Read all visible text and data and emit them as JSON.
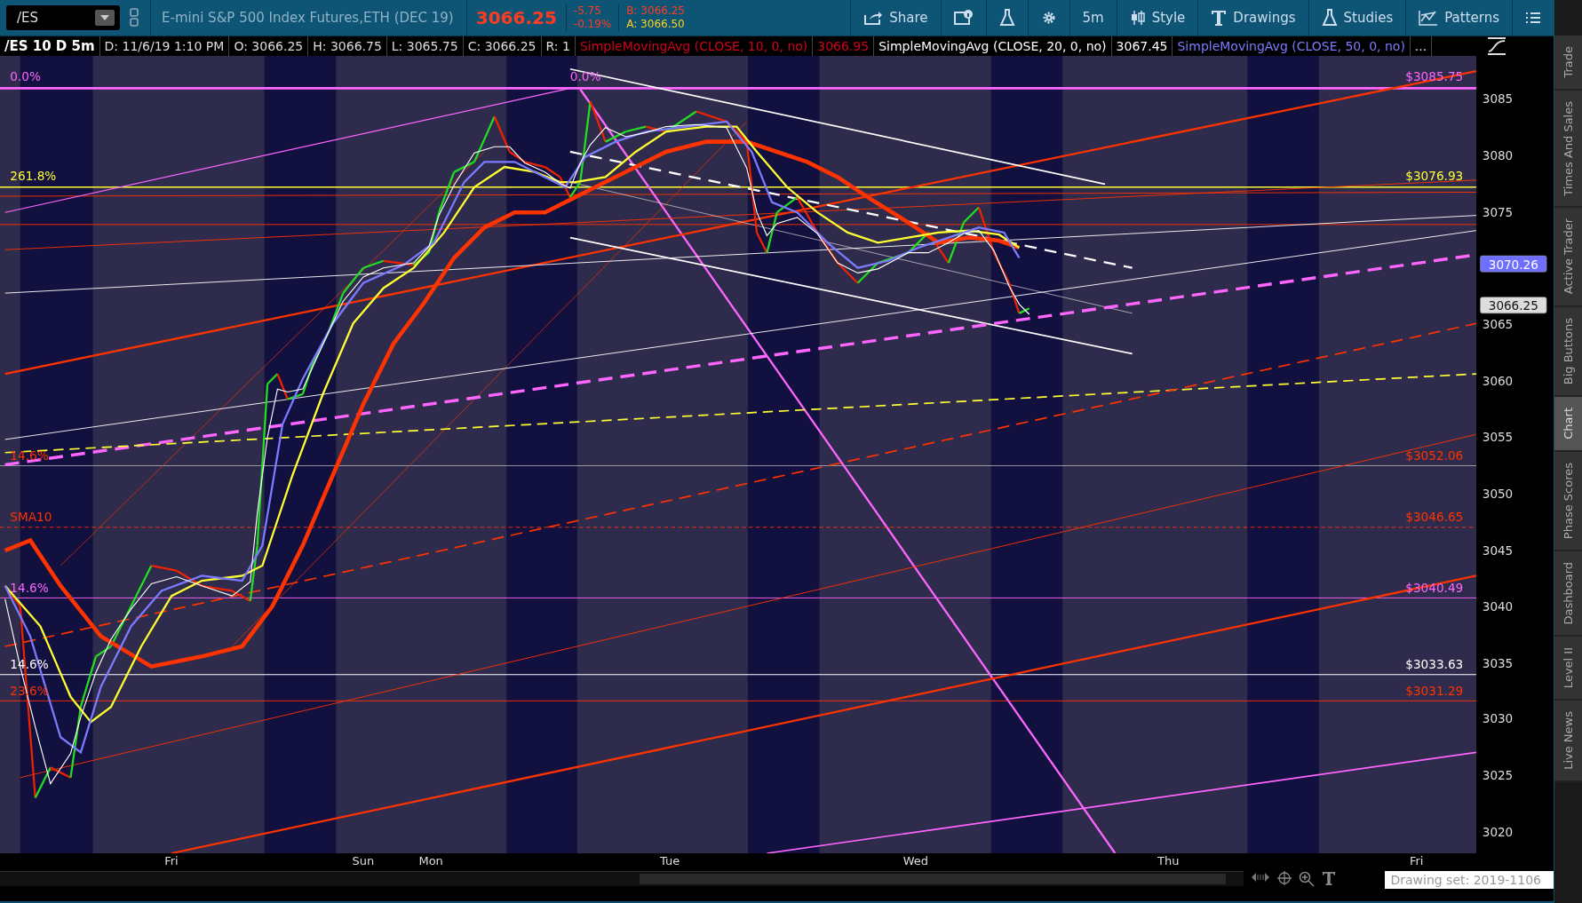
{
  "toolbar": {
    "symbol": "/ES",
    "description": "E-mini S&P 500 Index Futures,ETH (DEC 19)",
    "last": "3066.25",
    "change": "-5.75",
    "change_pct": "-0.19%",
    "bid": "B: 3066.25",
    "ask": "A: 3066.50",
    "buttons": [
      {
        "kind": "share",
        "label": "Share"
      },
      {
        "kind": "info"
      },
      {
        "kind": "flask"
      },
      {
        "kind": "gear"
      },
      {
        "kind": "text",
        "label": "5m"
      },
      {
        "kind": "style",
        "label": "Style"
      },
      {
        "kind": "drawings",
        "label": "Drawings"
      },
      {
        "kind": "studies",
        "label": "Studies"
      },
      {
        "kind": "patterns",
        "label": "Patterns"
      },
      {
        "kind": "menu"
      }
    ]
  },
  "info_bar": {
    "title": "/ES 10 D 5m",
    "fields": [
      "D: 11/6/19 1:10 PM",
      "O: 3066.25",
      "H: 3066.75",
      "L: 3065.75",
      "C: 3066.25",
      "R: 1"
    ],
    "studies": [
      {
        "name": "SimpleMovingAvg (CLOSE, 10, 0, no)",
        "value": "3066.95"
      },
      {
        "name": "SimpleMovingAvg (CLOSE, 20, 0, no)",
        "value": "3067.45"
      },
      {
        "name": "SimpleMovingAvg (CLOSE, 50, 0, no)"
      }
    ],
    "more": "..."
  },
  "chart": {
    "left_labels": [
      {
        "text": "0.0%",
        "color": "#ff66ff"
      },
      {
        "text": "0.0%",
        "color": "#ff66ff"
      },
      {
        "text": "261.8%",
        "color": "#ffff33"
      },
      {
        "text": "14.6%",
        "color": "#ff3300"
      },
      {
        "text": "SMA10",
        "color": "#ff3300"
      },
      {
        "text": "14.6%",
        "color": "#ff66ff"
      },
      {
        "text": "14.6%",
        "color": "#ffffff"
      },
      {
        "text": "23.6%",
        "color": "#ff3300"
      }
    ],
    "right_labels": [
      {
        "text": "$3085.75",
        "color": "#ff66ff"
      },
      {
        "text": "$3076.93",
        "color": "#ffff33"
      },
      {
        "text": "$3052.06",
        "color": "#ff3300"
      },
      {
        "text": "$3046.65",
        "color": "#ff3300"
      },
      {
        "text": "$3040.49",
        "color": "#ff66ff"
      },
      {
        "text": "$3033.63",
        "color": "#ffffff"
      },
      {
        "text": "$3031.29",
        "color": "#ff3300"
      }
    ],
    "price_axis": [
      "3085",
      "3080",
      "3075",
      "3065",
      "3060",
      "3055",
      "3050",
      "3045",
      "3040",
      "3035",
      "3030",
      "3025",
      "3020"
    ],
    "badges": [
      {
        "text": "3070.26",
        "kind": "study"
      },
      {
        "text": "3066.25",
        "kind": "last"
      }
    ],
    "time_axis": [
      "Fri",
      "Sun",
      "Mon",
      "Tue",
      "Wed",
      "Thu",
      "Fri"
    ]
  },
  "status": {
    "drawing_set": "Drawing set: 2019-1106"
  },
  "sidebar": [
    {
      "label": "Trade",
      "selected": false
    },
    {
      "label": "Times And Sales",
      "selected": false
    },
    {
      "label": "Active Trader",
      "selected": false
    },
    {
      "label": "Big Buttons",
      "selected": false
    },
    {
      "label": "Chart",
      "selected": true
    },
    {
      "label": "Phase Scores",
      "selected": false
    },
    {
      "label": "Dashboard",
      "selected": false
    },
    {
      "label": "Level II",
      "selected": false
    },
    {
      "label": "Live News",
      "selected": false
    }
  ]
}
